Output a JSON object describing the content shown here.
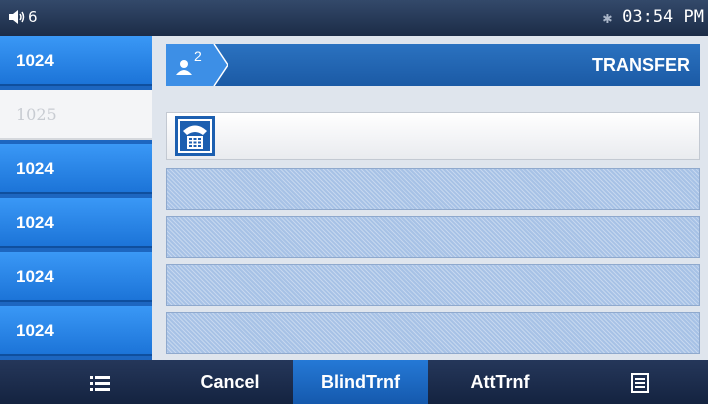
{
  "status": {
    "volume_icon": "speaker-volume-icon",
    "line_count": "6",
    "bluetooth_icon": "bluetooth-icon",
    "time": "03:54 PM"
  },
  "sidebar": {
    "items": [
      {
        "label": "1024"
      },
      {
        "label": "1025",
        "selected": true
      },
      {
        "label": "1024"
      },
      {
        "label": "1024"
      },
      {
        "label": "1024"
      },
      {
        "label": "1024"
      }
    ]
  },
  "header": {
    "icon": "user-icon",
    "badge_number": "2",
    "title": "TRANSFER"
  },
  "input": {
    "icon": "telephone-keypad-icon",
    "value": ""
  },
  "softkeys": {
    "menu_icon": "list-menu-icon",
    "cancel": "Cancel",
    "blind_transfer": "BlindTrnf",
    "attended_transfer": "AttTrnf",
    "more_icon": "more-menu-icon"
  },
  "colors": {
    "status_bar": "#1c2c47",
    "line_key": "#2a88ee",
    "header": "#2366b3",
    "active_softkey": "#1f6cc4",
    "empty_row": "#a7c2e6"
  }
}
